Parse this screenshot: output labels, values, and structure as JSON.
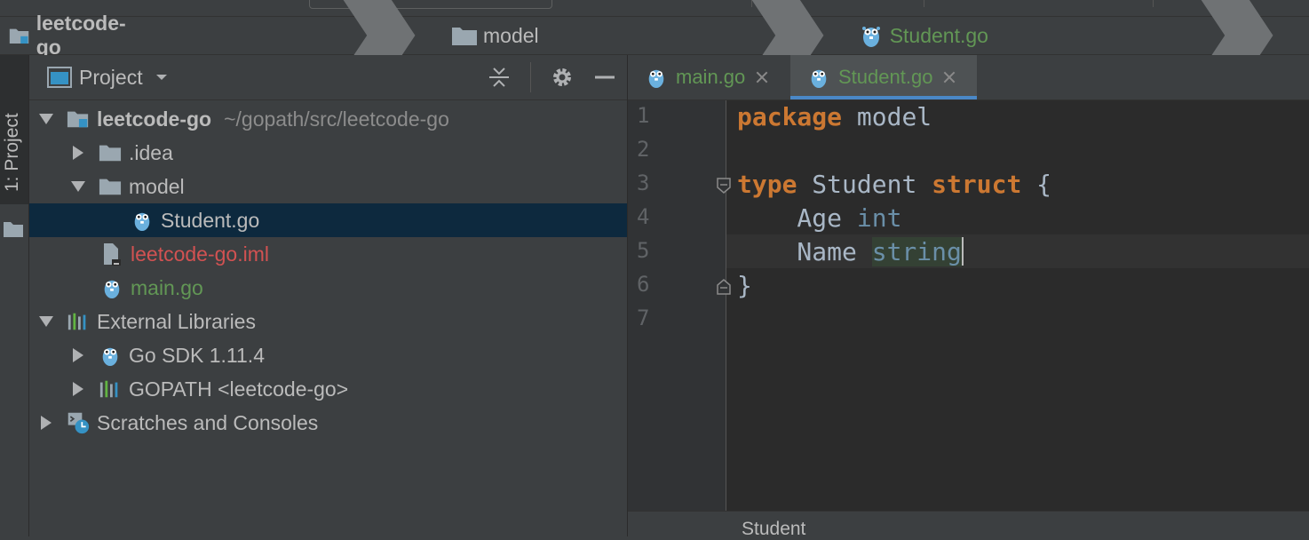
{
  "breadcrumb": {
    "project": "leetcode-go",
    "folder": "model",
    "file": "Student.go"
  },
  "tool_strip": {
    "project_tab": "1: Project"
  },
  "project_panel": {
    "title": "Project",
    "tree": [
      {
        "label": "leetcode-go",
        "path": "~/gopath/src/leetcode-go"
      },
      {
        "label": ".idea"
      },
      {
        "label": "model"
      },
      {
        "label": "Student.go"
      },
      {
        "label": "leetcode-go.iml"
      },
      {
        "label": "main.go"
      },
      {
        "label": "External Libraries"
      },
      {
        "label": "Go SDK 1.11.4"
      },
      {
        "label": "GOPATH <leetcode-go>"
      },
      {
        "label": "Scratches and Consoles"
      }
    ]
  },
  "editor": {
    "tabs": [
      {
        "label": "main.go"
      },
      {
        "label": "Student.go"
      }
    ],
    "line_numbers": [
      "1",
      "2",
      "3",
      "4",
      "5",
      "6",
      "7"
    ],
    "code": {
      "l1_kw": "package",
      "l1_rest": " model",
      "l3_kw1": "type",
      "l3_mid": " Student ",
      "l3_kw2": "struct",
      "l3_end": " {",
      "l4_field": "    Age ",
      "l4_type": "int",
      "l5_field": "    Name ",
      "l5_type": "string",
      "l6": "}"
    },
    "status_breadcrumb": "Student"
  },
  "colors": {
    "background": "#3c3f41",
    "editor_bg": "#2b2b2b",
    "selection": "#0d293e",
    "keyword": "#cc7832",
    "green_file": "#629755",
    "red_file": "#d25252",
    "tab_underline": "#4a88c7"
  }
}
